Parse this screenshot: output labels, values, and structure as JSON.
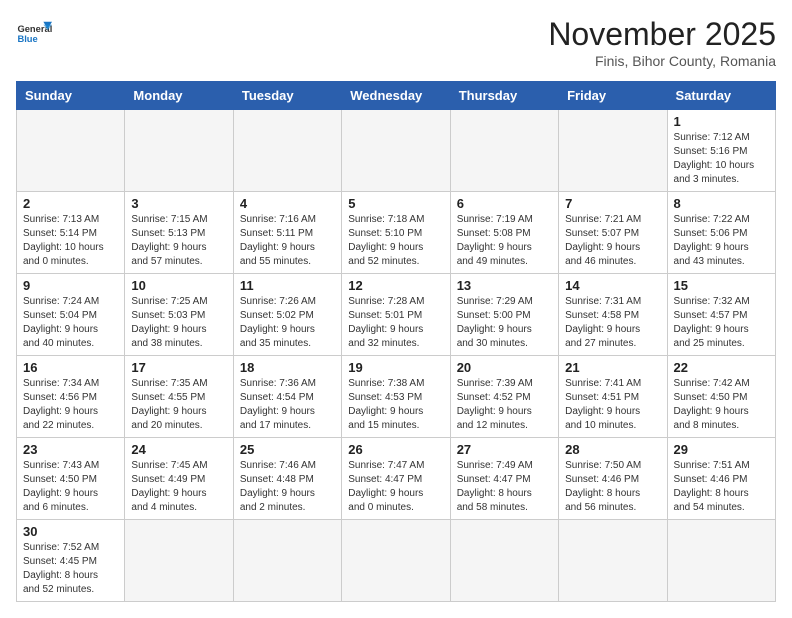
{
  "logo": {
    "text_general": "General",
    "text_blue": "Blue"
  },
  "header": {
    "month_year": "November 2025",
    "location": "Finis, Bihor County, Romania"
  },
  "weekdays": [
    "Sunday",
    "Monday",
    "Tuesday",
    "Wednesday",
    "Thursday",
    "Friday",
    "Saturday"
  ],
  "weeks": [
    [
      {
        "day": "",
        "info": ""
      },
      {
        "day": "",
        "info": ""
      },
      {
        "day": "",
        "info": ""
      },
      {
        "day": "",
        "info": ""
      },
      {
        "day": "",
        "info": ""
      },
      {
        "day": "",
        "info": ""
      },
      {
        "day": "1",
        "info": "Sunrise: 7:12 AM\nSunset: 5:16 PM\nDaylight: 10 hours\nand 3 minutes."
      }
    ],
    [
      {
        "day": "2",
        "info": "Sunrise: 7:13 AM\nSunset: 5:14 PM\nDaylight: 10 hours\nand 0 minutes."
      },
      {
        "day": "3",
        "info": "Sunrise: 7:15 AM\nSunset: 5:13 PM\nDaylight: 9 hours\nand 57 minutes."
      },
      {
        "day": "4",
        "info": "Sunrise: 7:16 AM\nSunset: 5:11 PM\nDaylight: 9 hours\nand 55 minutes."
      },
      {
        "day": "5",
        "info": "Sunrise: 7:18 AM\nSunset: 5:10 PM\nDaylight: 9 hours\nand 52 minutes."
      },
      {
        "day": "6",
        "info": "Sunrise: 7:19 AM\nSunset: 5:08 PM\nDaylight: 9 hours\nand 49 minutes."
      },
      {
        "day": "7",
        "info": "Sunrise: 7:21 AM\nSunset: 5:07 PM\nDaylight: 9 hours\nand 46 minutes."
      },
      {
        "day": "8",
        "info": "Sunrise: 7:22 AM\nSunset: 5:06 PM\nDaylight: 9 hours\nand 43 minutes."
      }
    ],
    [
      {
        "day": "9",
        "info": "Sunrise: 7:24 AM\nSunset: 5:04 PM\nDaylight: 9 hours\nand 40 minutes."
      },
      {
        "day": "10",
        "info": "Sunrise: 7:25 AM\nSunset: 5:03 PM\nDaylight: 9 hours\nand 38 minutes."
      },
      {
        "day": "11",
        "info": "Sunrise: 7:26 AM\nSunset: 5:02 PM\nDaylight: 9 hours\nand 35 minutes."
      },
      {
        "day": "12",
        "info": "Sunrise: 7:28 AM\nSunset: 5:01 PM\nDaylight: 9 hours\nand 32 minutes."
      },
      {
        "day": "13",
        "info": "Sunrise: 7:29 AM\nSunset: 5:00 PM\nDaylight: 9 hours\nand 30 minutes."
      },
      {
        "day": "14",
        "info": "Sunrise: 7:31 AM\nSunset: 4:58 PM\nDaylight: 9 hours\nand 27 minutes."
      },
      {
        "day": "15",
        "info": "Sunrise: 7:32 AM\nSunset: 4:57 PM\nDaylight: 9 hours\nand 25 minutes."
      }
    ],
    [
      {
        "day": "16",
        "info": "Sunrise: 7:34 AM\nSunset: 4:56 PM\nDaylight: 9 hours\nand 22 minutes."
      },
      {
        "day": "17",
        "info": "Sunrise: 7:35 AM\nSunset: 4:55 PM\nDaylight: 9 hours\nand 20 minutes."
      },
      {
        "day": "18",
        "info": "Sunrise: 7:36 AM\nSunset: 4:54 PM\nDaylight: 9 hours\nand 17 minutes."
      },
      {
        "day": "19",
        "info": "Sunrise: 7:38 AM\nSunset: 4:53 PM\nDaylight: 9 hours\nand 15 minutes."
      },
      {
        "day": "20",
        "info": "Sunrise: 7:39 AM\nSunset: 4:52 PM\nDaylight: 9 hours\nand 12 minutes."
      },
      {
        "day": "21",
        "info": "Sunrise: 7:41 AM\nSunset: 4:51 PM\nDaylight: 9 hours\nand 10 minutes."
      },
      {
        "day": "22",
        "info": "Sunrise: 7:42 AM\nSunset: 4:50 PM\nDaylight: 9 hours\nand 8 minutes."
      }
    ],
    [
      {
        "day": "23",
        "info": "Sunrise: 7:43 AM\nSunset: 4:50 PM\nDaylight: 9 hours\nand 6 minutes."
      },
      {
        "day": "24",
        "info": "Sunrise: 7:45 AM\nSunset: 4:49 PM\nDaylight: 9 hours\nand 4 minutes."
      },
      {
        "day": "25",
        "info": "Sunrise: 7:46 AM\nSunset: 4:48 PM\nDaylight: 9 hours\nand 2 minutes."
      },
      {
        "day": "26",
        "info": "Sunrise: 7:47 AM\nSunset: 4:47 PM\nDaylight: 9 hours\nand 0 minutes."
      },
      {
        "day": "27",
        "info": "Sunrise: 7:49 AM\nSunset: 4:47 PM\nDaylight: 8 hours\nand 58 minutes."
      },
      {
        "day": "28",
        "info": "Sunrise: 7:50 AM\nSunset: 4:46 PM\nDaylight: 8 hours\nand 56 minutes."
      },
      {
        "day": "29",
        "info": "Sunrise: 7:51 AM\nSunset: 4:46 PM\nDaylight: 8 hours\nand 54 minutes."
      }
    ],
    [
      {
        "day": "30",
        "info": "Sunrise: 7:52 AM\nSunset: 4:45 PM\nDaylight: 8 hours\nand 52 minutes."
      },
      {
        "day": "",
        "info": ""
      },
      {
        "day": "",
        "info": ""
      },
      {
        "day": "",
        "info": ""
      },
      {
        "day": "",
        "info": ""
      },
      {
        "day": "",
        "info": ""
      },
      {
        "day": "",
        "info": ""
      }
    ]
  ]
}
